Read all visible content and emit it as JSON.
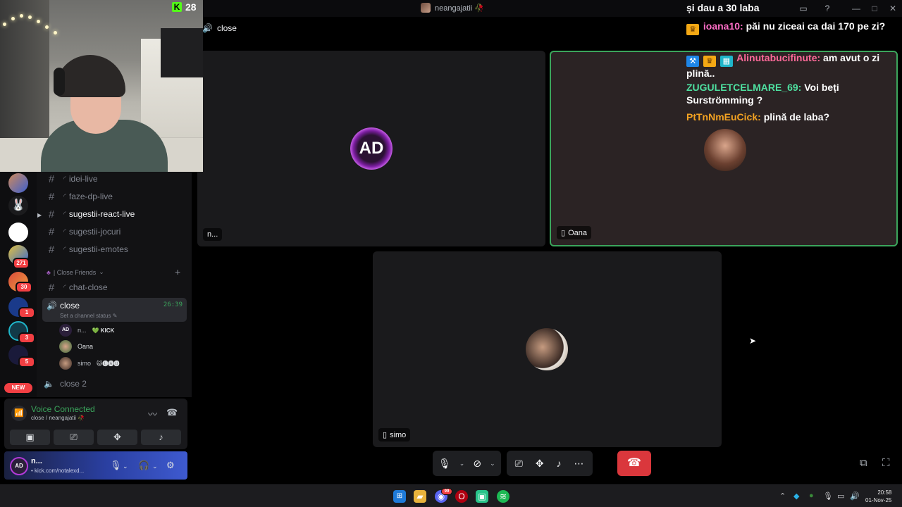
{
  "window": {
    "title": "neangajatii 🥀"
  },
  "kick": {
    "count": "28"
  },
  "servers": {
    "badges": [
      "271",
      "30",
      "1",
      "3",
      "5"
    ],
    "new_label": "NEW"
  },
  "channels": {
    "text": [
      {
        "name": "idei-live",
        "active": false
      },
      {
        "name": "faze-dp-live",
        "active": false
      },
      {
        "name": "sugestii-react-live",
        "active": true
      },
      {
        "name": "sugestii-jocuri",
        "active": false
      },
      {
        "name": "sugestii-emotes",
        "active": false
      }
    ],
    "category": "| Close Friends",
    "chat_close": "chat-close",
    "voice": {
      "name": "close",
      "status": "Set a channel status",
      "time": "26:39",
      "users": [
        {
          "name": "n...",
          "tag": "💚 KICK"
        },
        {
          "name": "Oana",
          "tag": ""
        },
        {
          "name": "simo",
          "tag": "🐱🅛🅐🅤"
        }
      ]
    },
    "close2": "close 2"
  },
  "voice_panel": {
    "title": "Voice Connected",
    "sub": "close / neangajatii 🥀"
  },
  "user_panel": {
    "avatar": "AD",
    "name": "n...",
    "status": "• kick.com/notalexd..."
  },
  "main": {
    "channel": "close",
    "tiles": [
      {
        "label": "n...",
        "avatar": "AD"
      },
      {
        "label": "Oana"
      },
      {
        "label": "simo"
      }
    ]
  },
  "chat": [
    {
      "user": "",
      "text": "și dau a 30 laba",
      "color": "#ffffff"
    },
    {
      "user": "ioana10:",
      "text": "păi nu ziceai ca dai 170 pe zi?",
      "color": "#ff6ec7"
    },
    {
      "user": "Alinutabucifinute:",
      "text": "am avut o zi plină..",
      "color": "#ff6a9a"
    },
    {
      "user": "ZUGULETCELMARE_69:",
      "text": "Voi beți Surströmming ?",
      "color": "#4ee0a0"
    },
    {
      "user": "PtTnNmEuCick:",
      "text": "plină de laba?",
      "color": "#f4a322"
    }
  ],
  "taskbar": {
    "time": "20:58",
    "date": "01-Nov-25",
    "discord_badge": "99"
  },
  "colors": {
    "accent_green": "#3ba55c",
    "hangup_red": "#da373c",
    "kick_green": "#53fc18"
  }
}
